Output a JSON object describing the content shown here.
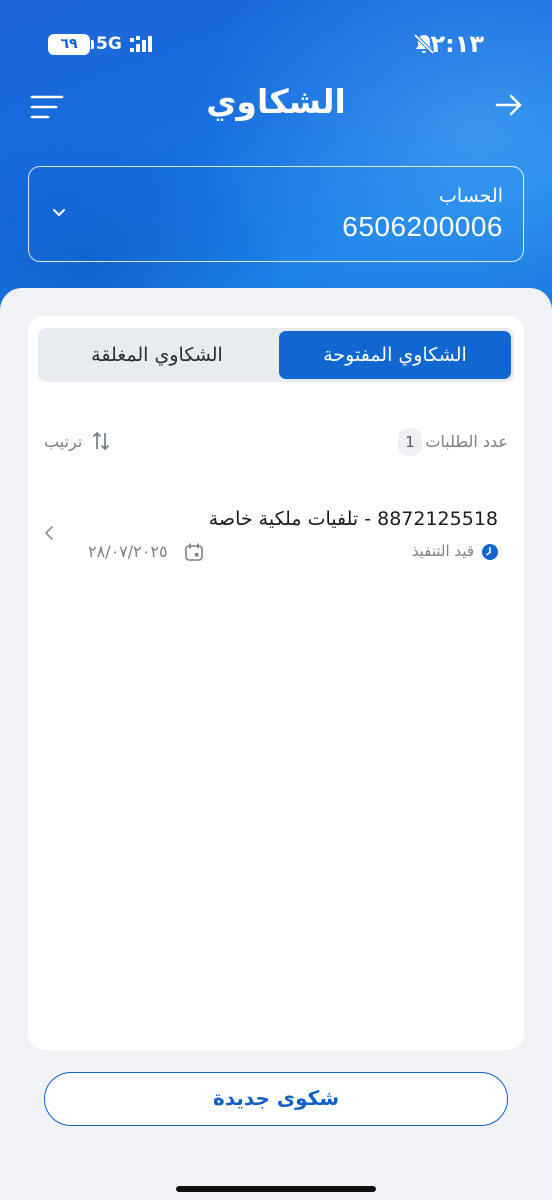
{
  "status_bar": {
    "time": "٢:١٣",
    "battery": "٦٩",
    "network": "5G"
  },
  "header": {
    "title": "الشكاوي"
  },
  "account": {
    "label": "الحساب",
    "number": "6506200006"
  },
  "tabs": {
    "open_label": "الشكاوي المفتوحة",
    "closed_label": "الشكاوي المغلقة",
    "active": "open"
  },
  "list_header": {
    "count_label": "عدد الطلبات",
    "count": "1",
    "sort_label": "ترتيب"
  },
  "complaints": [
    {
      "title": "8872125518 - تلفيات ملكية خاصة",
      "status": "قيد التنفيذ",
      "date": "٢٨/٠٧/٢٠٢٥"
    }
  ],
  "actions": {
    "new_complaint_label": "شكوى جديدة"
  },
  "colors": {
    "brand_blue": "#1166cf",
    "muted_text": "#7c8088"
  }
}
